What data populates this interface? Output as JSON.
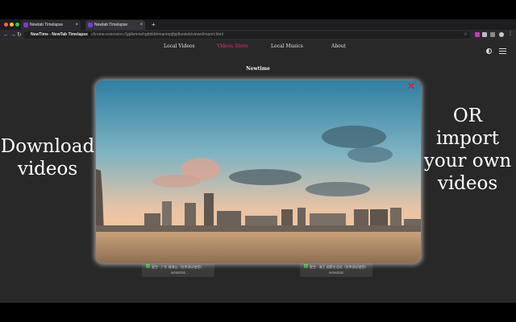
{
  "browser": {
    "tabs": [
      {
        "label": "Newtab Timelapse"
      },
      {
        "label": "Newtab Timelapse"
      }
    ],
    "new_tab_symbol": "+",
    "tab_close_symbol": "×",
    "nav": {
      "back": "←",
      "forward": "→",
      "reload": "↻"
    },
    "address": {
      "site_label": "NewTime - NewTab Timelapse",
      "url": "chrome-extension://gplkmmehgbhkbhmanmpjfpjdkeeleb/views/import.html",
      "star": "☆"
    }
  },
  "page": {
    "nav_items": [
      {
        "label": "Local  Videos",
        "active": false
      },
      {
        "label": "Videos Store",
        "active": true
      },
      {
        "label": "Local Musics",
        "active": false
      },
      {
        "label": "About",
        "active": false
      }
    ],
    "brand": "Newtime",
    "left_promo": "Download videos",
    "right_promo": "OR import your own videos",
    "cards": [
      {
        "title": "星空 · 广东 珠海山（仅供测试使用）",
        "date": "5/25/2020"
      },
      {
        "title": "星空 · 海王 观察台北站（仅供测试使用）",
        "date": "5/25/2020"
      }
    ],
    "close_symbol": "✕"
  },
  "colors": {
    "accent": "#e0357f",
    "close": "#e02020",
    "page_bg": "#282828"
  }
}
